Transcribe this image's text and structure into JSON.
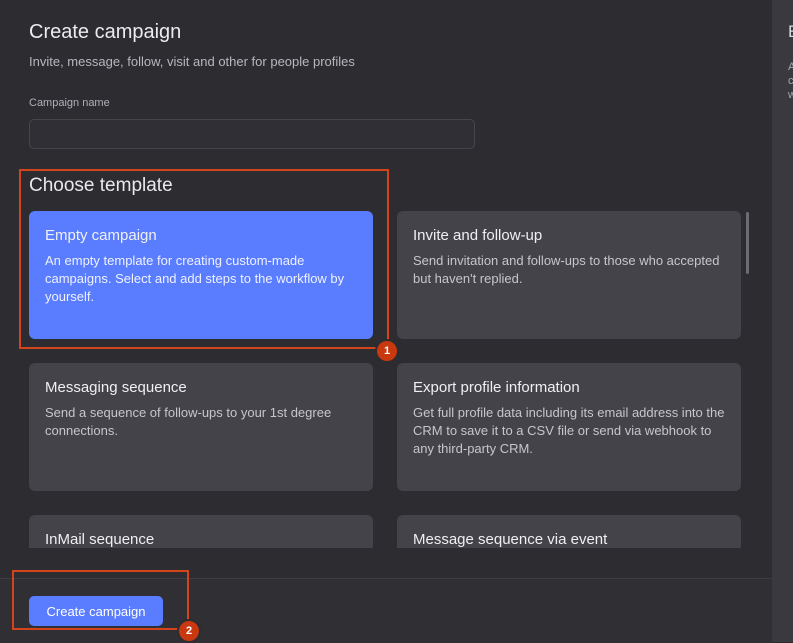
{
  "page": {
    "title": "Create campaign",
    "subtitle": "Invite, message, follow, visit and other for people profiles"
  },
  "form": {
    "campaign_name_label": "Campaign name",
    "campaign_name_value": "",
    "campaign_name_placeholder": ""
  },
  "templates": {
    "heading": "Choose template",
    "items": [
      {
        "title": "Empty campaign",
        "description": "An empty template for creating custom-made campaigns. Select and add steps to the workflow by yourself.",
        "selected": true
      },
      {
        "title": "Invite and follow-up",
        "description": "Send invitation and follow-ups to those who accepted but haven't replied.",
        "selected": false
      },
      {
        "title": "Messaging sequence",
        "description": "Send a sequence of follow-ups to your 1st degree connections.",
        "selected": false
      },
      {
        "title": "Export profile information",
        "description": "Get full profile data including its email address into the CRM to save it to a CSV file or send via webhook to any third-party CRM.",
        "selected": false
      },
      {
        "title": "InMail sequence",
        "description": "",
        "selected": false
      },
      {
        "title": "Message sequence via event",
        "description": "",
        "selected": false
      }
    ]
  },
  "footer": {
    "create_label": "Create campaign"
  },
  "annotations": {
    "badge_1": "1",
    "badge_2": "2",
    "color": "#d4441c"
  },
  "side_panel": {
    "heading_fragment": "E",
    "line_fragments": [
      "A",
      "c",
      "w"
    ]
  },
  "colors": {
    "accent": "#5a7dff",
    "background": "#2c2c31",
    "card": "#434349"
  }
}
